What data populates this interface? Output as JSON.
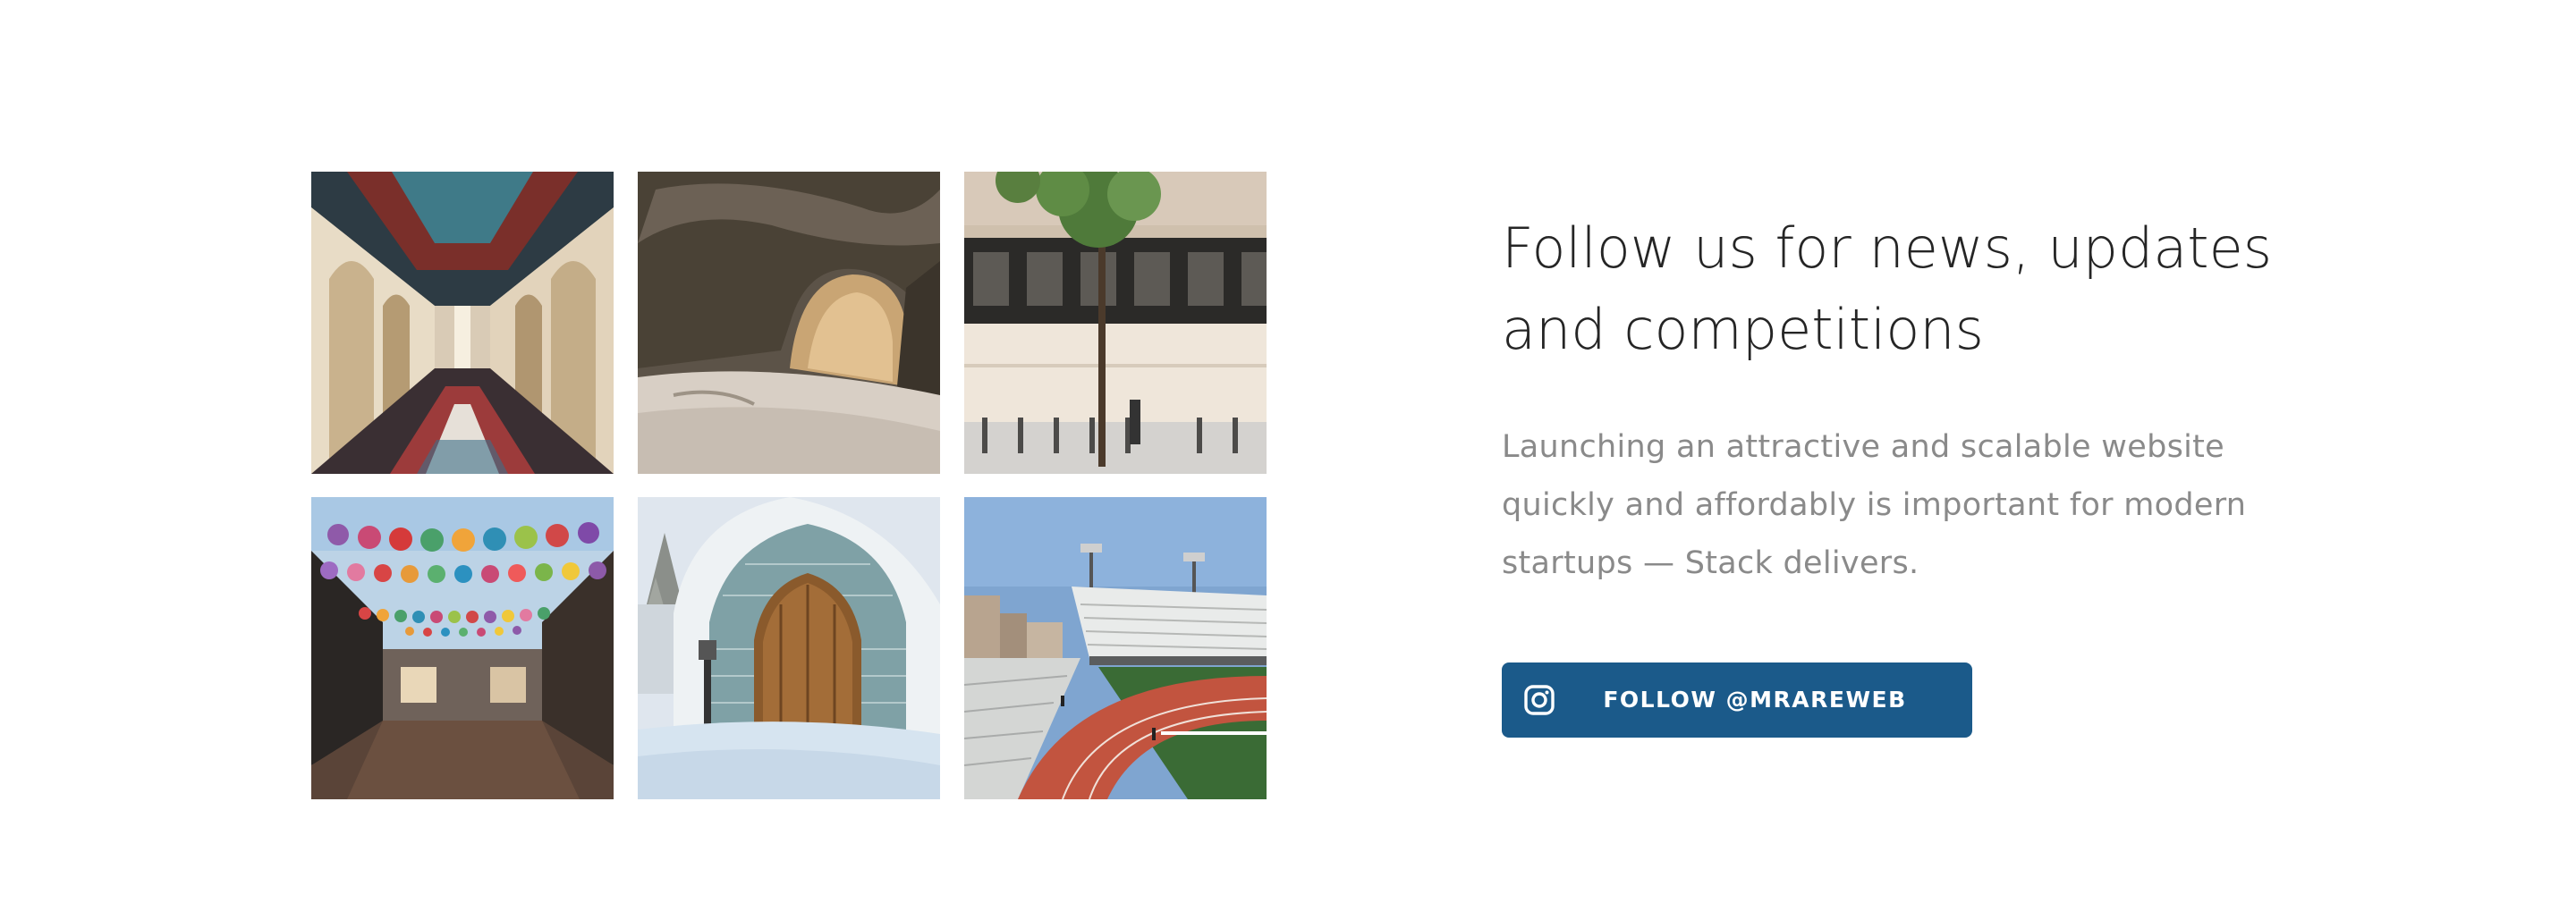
{
  "feed": {
    "photos": [
      {
        "label": "corridor-photo"
      },
      {
        "label": "cave-arch-photo"
      },
      {
        "label": "building-tree-photo"
      },
      {
        "label": "lanterns-street-photo"
      },
      {
        "label": "ice-chapel-photo"
      },
      {
        "label": "stadium-track-photo"
      }
    ]
  },
  "copy": {
    "headline_line1": "Follow us for news, updates",
    "headline_line2": "and competitions",
    "lead": "Launching an attractive and scalable website quickly and affordably is important for modern startups — Stack delivers."
  },
  "cta": {
    "icon": "instagram-icon",
    "label": "FOLLOW @MRAREWEB",
    "color": "#1b5a8a"
  }
}
